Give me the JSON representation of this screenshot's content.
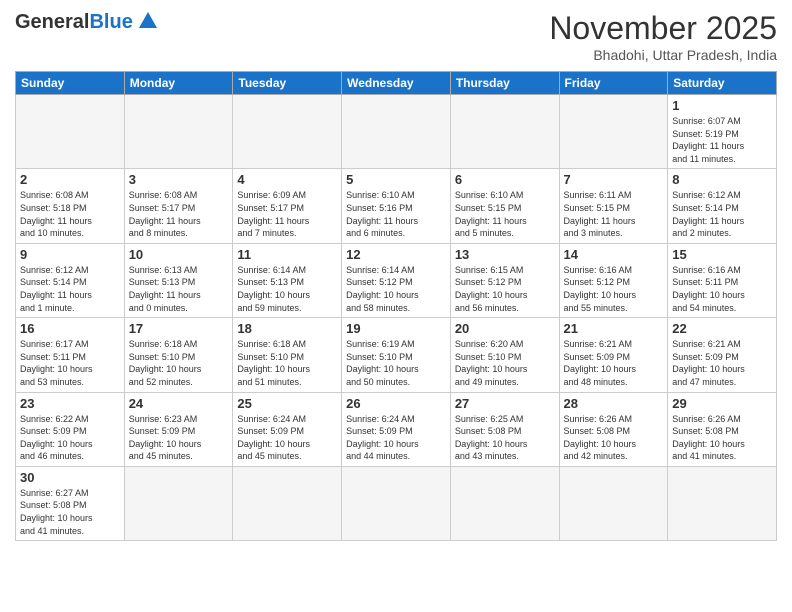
{
  "header": {
    "logo_general": "General",
    "logo_blue": "Blue",
    "month_title": "November 2025",
    "subtitle": "Bhadohi, Uttar Pradesh, India"
  },
  "weekdays": [
    "Sunday",
    "Monday",
    "Tuesday",
    "Wednesday",
    "Thursday",
    "Friday",
    "Saturday"
  ],
  "weeks": [
    [
      {
        "day": "",
        "info": ""
      },
      {
        "day": "",
        "info": ""
      },
      {
        "day": "",
        "info": ""
      },
      {
        "day": "",
        "info": ""
      },
      {
        "day": "",
        "info": ""
      },
      {
        "day": "",
        "info": ""
      },
      {
        "day": "1",
        "info": "Sunrise: 6:07 AM\nSunset: 5:19 PM\nDaylight: 11 hours\nand 11 minutes."
      }
    ],
    [
      {
        "day": "2",
        "info": "Sunrise: 6:08 AM\nSunset: 5:18 PM\nDaylight: 11 hours\nand 10 minutes."
      },
      {
        "day": "3",
        "info": "Sunrise: 6:08 AM\nSunset: 5:17 PM\nDaylight: 11 hours\nand 8 minutes."
      },
      {
        "day": "4",
        "info": "Sunrise: 6:09 AM\nSunset: 5:17 PM\nDaylight: 11 hours\nand 7 minutes."
      },
      {
        "day": "5",
        "info": "Sunrise: 6:10 AM\nSunset: 5:16 PM\nDaylight: 11 hours\nand 6 minutes."
      },
      {
        "day": "6",
        "info": "Sunrise: 6:10 AM\nSunset: 5:15 PM\nDaylight: 11 hours\nand 5 minutes."
      },
      {
        "day": "7",
        "info": "Sunrise: 6:11 AM\nSunset: 5:15 PM\nDaylight: 11 hours\nand 3 minutes."
      },
      {
        "day": "8",
        "info": "Sunrise: 6:12 AM\nSunset: 5:14 PM\nDaylight: 11 hours\nand 2 minutes."
      }
    ],
    [
      {
        "day": "9",
        "info": "Sunrise: 6:12 AM\nSunset: 5:14 PM\nDaylight: 11 hours\nand 1 minute."
      },
      {
        "day": "10",
        "info": "Sunrise: 6:13 AM\nSunset: 5:13 PM\nDaylight: 11 hours\nand 0 minutes."
      },
      {
        "day": "11",
        "info": "Sunrise: 6:14 AM\nSunset: 5:13 PM\nDaylight: 10 hours\nand 59 minutes."
      },
      {
        "day": "12",
        "info": "Sunrise: 6:14 AM\nSunset: 5:12 PM\nDaylight: 10 hours\nand 58 minutes."
      },
      {
        "day": "13",
        "info": "Sunrise: 6:15 AM\nSunset: 5:12 PM\nDaylight: 10 hours\nand 56 minutes."
      },
      {
        "day": "14",
        "info": "Sunrise: 6:16 AM\nSunset: 5:12 PM\nDaylight: 10 hours\nand 55 minutes."
      },
      {
        "day": "15",
        "info": "Sunrise: 6:16 AM\nSunset: 5:11 PM\nDaylight: 10 hours\nand 54 minutes."
      }
    ],
    [
      {
        "day": "16",
        "info": "Sunrise: 6:17 AM\nSunset: 5:11 PM\nDaylight: 10 hours\nand 53 minutes."
      },
      {
        "day": "17",
        "info": "Sunrise: 6:18 AM\nSunset: 5:10 PM\nDaylight: 10 hours\nand 52 minutes."
      },
      {
        "day": "18",
        "info": "Sunrise: 6:18 AM\nSunset: 5:10 PM\nDaylight: 10 hours\nand 51 minutes."
      },
      {
        "day": "19",
        "info": "Sunrise: 6:19 AM\nSunset: 5:10 PM\nDaylight: 10 hours\nand 50 minutes."
      },
      {
        "day": "20",
        "info": "Sunrise: 6:20 AM\nSunset: 5:10 PM\nDaylight: 10 hours\nand 49 minutes."
      },
      {
        "day": "21",
        "info": "Sunrise: 6:21 AM\nSunset: 5:09 PM\nDaylight: 10 hours\nand 48 minutes."
      },
      {
        "day": "22",
        "info": "Sunrise: 6:21 AM\nSunset: 5:09 PM\nDaylight: 10 hours\nand 47 minutes."
      }
    ],
    [
      {
        "day": "23",
        "info": "Sunrise: 6:22 AM\nSunset: 5:09 PM\nDaylight: 10 hours\nand 46 minutes."
      },
      {
        "day": "24",
        "info": "Sunrise: 6:23 AM\nSunset: 5:09 PM\nDaylight: 10 hours\nand 45 minutes."
      },
      {
        "day": "25",
        "info": "Sunrise: 6:24 AM\nSunset: 5:09 PM\nDaylight: 10 hours\nand 45 minutes."
      },
      {
        "day": "26",
        "info": "Sunrise: 6:24 AM\nSunset: 5:09 PM\nDaylight: 10 hours\nand 44 minutes."
      },
      {
        "day": "27",
        "info": "Sunrise: 6:25 AM\nSunset: 5:08 PM\nDaylight: 10 hours\nand 43 minutes."
      },
      {
        "day": "28",
        "info": "Sunrise: 6:26 AM\nSunset: 5:08 PM\nDaylight: 10 hours\nand 42 minutes."
      },
      {
        "day": "29",
        "info": "Sunrise: 6:26 AM\nSunset: 5:08 PM\nDaylight: 10 hours\nand 41 minutes."
      }
    ],
    [
      {
        "day": "30",
        "info": "Sunrise: 6:27 AM\nSunset: 5:08 PM\nDaylight: 10 hours\nand 41 minutes."
      },
      {
        "day": "",
        "info": ""
      },
      {
        "day": "",
        "info": ""
      },
      {
        "day": "",
        "info": ""
      },
      {
        "day": "",
        "info": ""
      },
      {
        "day": "",
        "info": ""
      },
      {
        "day": "",
        "info": ""
      }
    ]
  ]
}
